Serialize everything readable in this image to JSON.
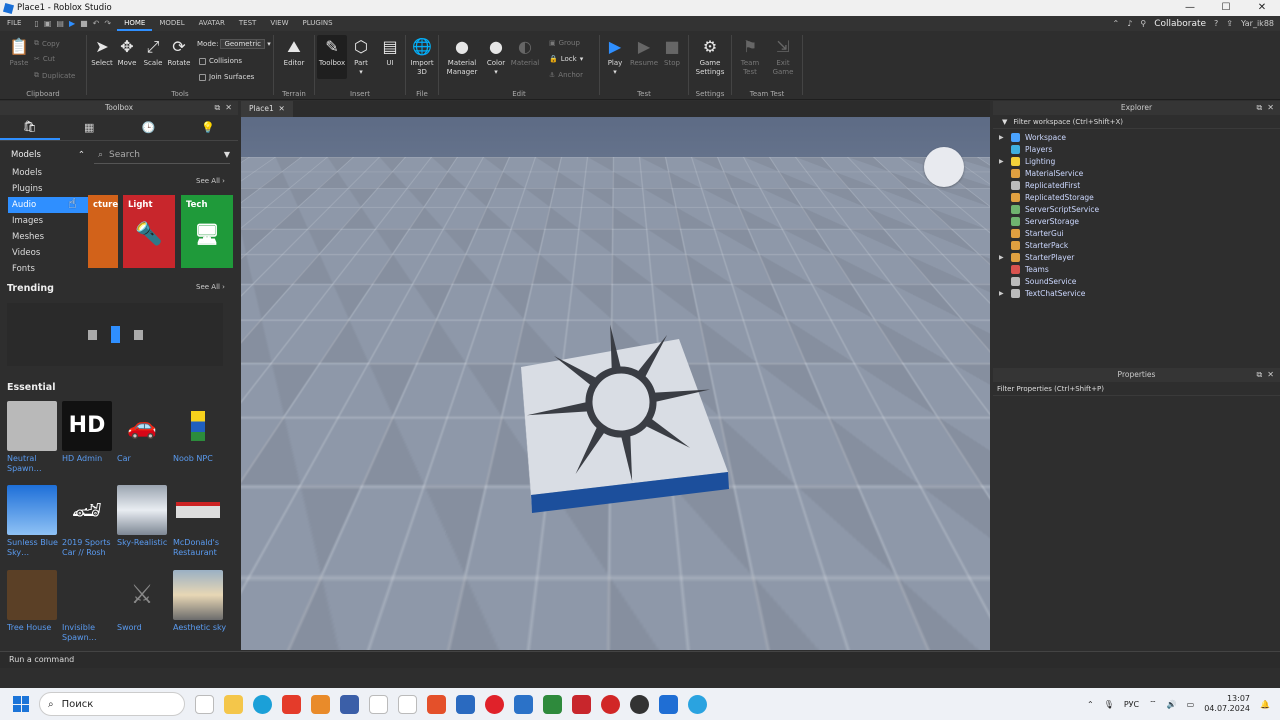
{
  "window": {
    "title": "Place1 - Roblox Studio",
    "min": "—",
    "max": "☐",
    "close": "✕"
  },
  "menubar": {
    "items": [
      "FILE",
      "HOME",
      "MODEL",
      "AVATAR",
      "TEST",
      "VIEW",
      "PLUGINS"
    ],
    "active": "HOME",
    "collaborate": "Collaborate",
    "username": "Yar_ik88"
  },
  "ribbon": {
    "clipboard": {
      "paste": "Paste",
      "copy": "Copy",
      "cut": "Cut",
      "duplicate": "Duplicate",
      "label": "Clipboard"
    },
    "tools": {
      "select": "Select",
      "move": "Move",
      "scale": "Scale",
      "rotate": "Rotate",
      "mode_label": "Mode:",
      "mode_value": "Geometric",
      "collisions": "Collisions",
      "join": "Join Surfaces",
      "label": "Tools"
    },
    "terrain": {
      "editor": "Editor",
      "label": "Terrain"
    },
    "insert": {
      "toolbox": "Toolbox",
      "part": "Part",
      "ui": "UI",
      "label": "Insert"
    },
    "file": {
      "import": "Import 3D",
      "label": "File"
    },
    "edit": {
      "material_manager": "Material Manager",
      "color": "Color",
      "material": "Material",
      "group": "Group",
      "lock": "Lock",
      "anchor": "Anchor",
      "label": "Edit"
    },
    "test": {
      "play": "Play",
      "resume": "Resume",
      "stop": "Stop",
      "label": "Test"
    },
    "settings": {
      "game_settings": "Game Settings",
      "label": "Settings"
    },
    "team_test": {
      "team_test": "Team Test",
      "exit_game": "Exit Game",
      "label": "Team Test"
    }
  },
  "toolbox": {
    "title": "Toolbox",
    "category": "Models",
    "search_placeholder": "Search",
    "dropdown": [
      "Models",
      "Plugins",
      "Audio",
      "Images",
      "Meshes",
      "Videos",
      "Fonts"
    ],
    "selected": "Audio",
    "see_all": "See All ›",
    "categories": [
      {
        "name": "cture",
        "color": "#d2621a"
      },
      {
        "name": "Light",
        "color": "#c8262c"
      },
      {
        "name": "Tech",
        "color": "#1f9a3a"
      }
    ],
    "trending": "Trending",
    "essential": "Essential",
    "items": [
      {
        "name": "Neutral Spawn…"
      },
      {
        "name": "HD Admin"
      },
      {
        "name": "Car"
      },
      {
        "name": "Noob NPC"
      },
      {
        "name": "Sunless Blue Sky…"
      },
      {
        "name": "2019 Sports Car // Rosh"
      },
      {
        "name": "Sky-Realistic"
      },
      {
        "name": "McDonald's Restaurant"
      },
      {
        "name": "Tree House"
      },
      {
        "name": "Invisible Spawn…"
      },
      {
        "name": "Sword"
      },
      {
        "name": "Aesthetic sky"
      }
    ],
    "hd_text": "HD"
  },
  "viewport": {
    "tab": "Place1"
  },
  "explorer": {
    "title": "Explorer",
    "filter": "Filter workspace (Ctrl+Shift+X)",
    "nodes": [
      {
        "name": "Workspace",
        "expandable": true,
        "color": "#4aa3ff"
      },
      {
        "name": "Players",
        "expandable": false,
        "color": "#3fb0e0"
      },
      {
        "name": "Lighting",
        "expandable": true,
        "color": "#f3d13a"
      },
      {
        "name": "MaterialService",
        "expandable": false,
        "color": "#e0a040"
      },
      {
        "name": "ReplicatedFirst",
        "expandable": false,
        "color": "#bbbbbb"
      },
      {
        "name": "ReplicatedStorage",
        "expandable": false,
        "color": "#e0a040"
      },
      {
        "name": "ServerScriptService",
        "expandable": false,
        "color": "#6fb36f"
      },
      {
        "name": "ServerStorage",
        "expandable": false,
        "color": "#6fb36f"
      },
      {
        "name": "StarterGui",
        "expandable": false,
        "color": "#e0a040"
      },
      {
        "name": "StarterPack",
        "expandable": false,
        "color": "#e0a040"
      },
      {
        "name": "StarterPlayer",
        "expandable": true,
        "color": "#e0a040"
      },
      {
        "name": "Teams",
        "expandable": false,
        "color": "#d9534f"
      },
      {
        "name": "SoundService",
        "expandable": false,
        "color": "#bbbbbb"
      },
      {
        "name": "TextChatService",
        "expandable": true,
        "color": "#bbbbbb"
      }
    ]
  },
  "properties": {
    "title": "Properties",
    "filter": "Filter Properties (Ctrl+Shift+P)"
  },
  "command": {
    "placeholder": "Run a command"
  },
  "taskbar": {
    "search": "Поиск",
    "lang": "РУС",
    "time": "13:07",
    "date": "04.07.2024"
  }
}
